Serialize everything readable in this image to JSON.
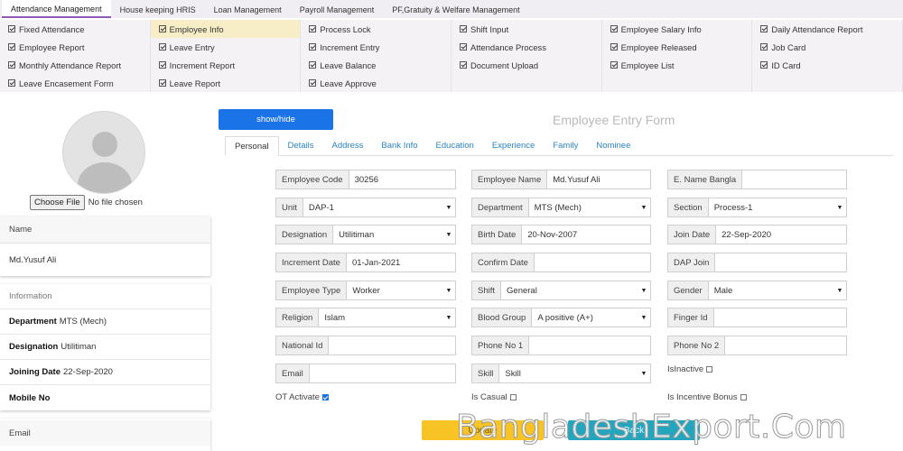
{
  "topnav": [
    "Attendance Management",
    "House keeping HRIS",
    "Loan Management",
    "Payroll Management",
    "PF,Gratuity & Welfare Management"
  ],
  "menu": [
    [
      "Fixed Attendance",
      "Employee Info",
      "Process Lock",
      "Shift Input",
      "Employee Salary Info",
      "Daily Attendance Report"
    ],
    [
      "Employee Report",
      "Leave Entry",
      "Increment Entry",
      "Attendance Process",
      "Employee Released",
      "Job Card"
    ],
    [
      "Monthly Attendance Report",
      "Increment Report",
      "Leave Balance",
      "Document Upload",
      "Employee List",
      "ID Card"
    ],
    [
      "Leave Encasement Form",
      "Leave Report",
      "Leave Approve",
      "",
      "",
      ""
    ]
  ],
  "left": {
    "choose_file": "Choose File",
    "no_file": "No file chosen",
    "name_header": "Name",
    "name_value": "Md.Yusuf Ali",
    "info_header": "Information",
    "dept_label": "Department",
    "dept_value": "MTS (Mech)",
    "desig_label": "Designation",
    "desig_value": "Utilitiman",
    "join_label": "Joining Date",
    "join_value": "22-Sep-2020",
    "mobile_label": "Mobile No",
    "email_header": "Email"
  },
  "form": {
    "showhide": "show/hide",
    "title": "Employee Entry Form",
    "tabs": [
      "Personal",
      "Details",
      "Address",
      "Bank Info",
      "Education",
      "Experience",
      "Family",
      "Nominee"
    ],
    "fields": {
      "emp_code": {
        "label": "Employee Code",
        "value": "30256"
      },
      "emp_name": {
        "label": "Employee Name",
        "value": "Md.Yusuf Ali"
      },
      "name_bangla": {
        "label": "E. Name Bangla",
        "value": ""
      },
      "unit": {
        "label": "Unit",
        "value": "DAP-1"
      },
      "department": {
        "label": "Department",
        "value": "MTS (Mech)"
      },
      "section": {
        "label": "Section",
        "value": "Process-1"
      },
      "designation": {
        "label": "Designation",
        "value": "Utilitiman"
      },
      "birth_date": {
        "label": "Birth Date",
        "value": "20-Nov-2007"
      },
      "join_date": {
        "label": "Join Date",
        "value": "22-Sep-2020"
      },
      "increment_date": {
        "label": "Increment Date",
        "value": "01-Jan-2021"
      },
      "confirm_date": {
        "label": "Confirm Date",
        "value": ""
      },
      "dap_join": {
        "label": "DAP Join",
        "value": ""
      },
      "emp_type": {
        "label": "Employee Type",
        "value": "Worker"
      },
      "shift": {
        "label": "Shift",
        "value": "General"
      },
      "gender": {
        "label": "Gender",
        "value": "Male"
      },
      "religion": {
        "label": "Religion",
        "value": "Islam"
      },
      "blood_group": {
        "label": "Blood Group",
        "value": "A positive (A+)"
      },
      "finger_id": {
        "label": "Finger Id",
        "value": ""
      },
      "national_id": {
        "label": "National Id",
        "value": ""
      },
      "phone1": {
        "label": "Phone No 1",
        "value": ""
      },
      "phone2": {
        "label": "Phone No 2",
        "value": ""
      },
      "email": {
        "label": "Email",
        "value": ""
      },
      "skill": {
        "label": "Skill",
        "value": "Skill"
      }
    },
    "checks": {
      "isinactive": {
        "label": "IsInactive",
        "checked": false
      },
      "ot_activate": {
        "label": "OT Activate",
        "checked": true
      },
      "is_casual": {
        "label": "Is Casual",
        "checked": false
      },
      "is_incentive": {
        "label": "Is Incentive Bonus",
        "checked": false
      }
    },
    "update": "Update",
    "back": "Back"
  },
  "watermark": "BangladeshExport.Com",
  "colors": {
    "accent": "#1b73e8",
    "update": "#f7c325",
    "back": "#23a6bd",
    "highlight": "#f7edc6"
  }
}
